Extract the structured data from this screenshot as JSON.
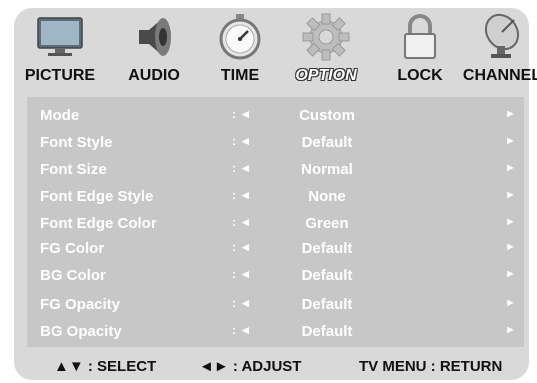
{
  "tabs": [
    {
      "label": "PICTURE",
      "icon": "monitor-icon",
      "active": false
    },
    {
      "label": "AUDIO",
      "icon": "speaker-icon",
      "active": false
    },
    {
      "label": "TIME",
      "icon": "stopwatch-icon",
      "active": false
    },
    {
      "label": "OPTION",
      "icon": "gear-icon",
      "active": true
    },
    {
      "label": "LOCK",
      "icon": "padlock-icon",
      "active": false
    },
    {
      "label": "CHANNEL",
      "icon": "satellite-dish-icon",
      "active": false
    }
  ],
  "rows": [
    {
      "name": "Mode",
      "sep": ": ◄",
      "value": "Custom",
      "arrow": "►"
    },
    {
      "name": "Font Style",
      "sep": ": ◄",
      "value": "Default",
      "arrow": "►"
    },
    {
      "name": "Font Size",
      "sep": ": ◄",
      "value": "Normal",
      "arrow": "►"
    },
    {
      "name": "Font Edge Style",
      "sep": ": ◄",
      "value": "None",
      "arrow": "►"
    },
    {
      "name": "Font Edge Color",
      "sep": ": ◄",
      "value": "Green",
      "arrow": "►"
    },
    {
      "name": "FG Color",
      "sep": ": ◄",
      "value": "Default",
      "arrow": "►"
    },
    {
      "name": "BG Color",
      "sep": ": ◄",
      "value": "Default",
      "arrow": "►"
    },
    {
      "name": "FG Opacity",
      "sep": ": ◄",
      "value": "Default",
      "arrow": "►"
    },
    {
      "name": "BG Opacity",
      "sep": ": ◄",
      "value": "Default",
      "arrow": "►"
    }
  ],
  "footer": {
    "select": "▲▼ : SELECT",
    "adjust": "◄► : ADJUST",
    "return": "TV MENU : RETURN"
  },
  "colors": {
    "frame": "#d9d9d9",
    "panel": "#c7c7c7",
    "row_text": "#ffffff",
    "footer_text": "#111111"
  }
}
